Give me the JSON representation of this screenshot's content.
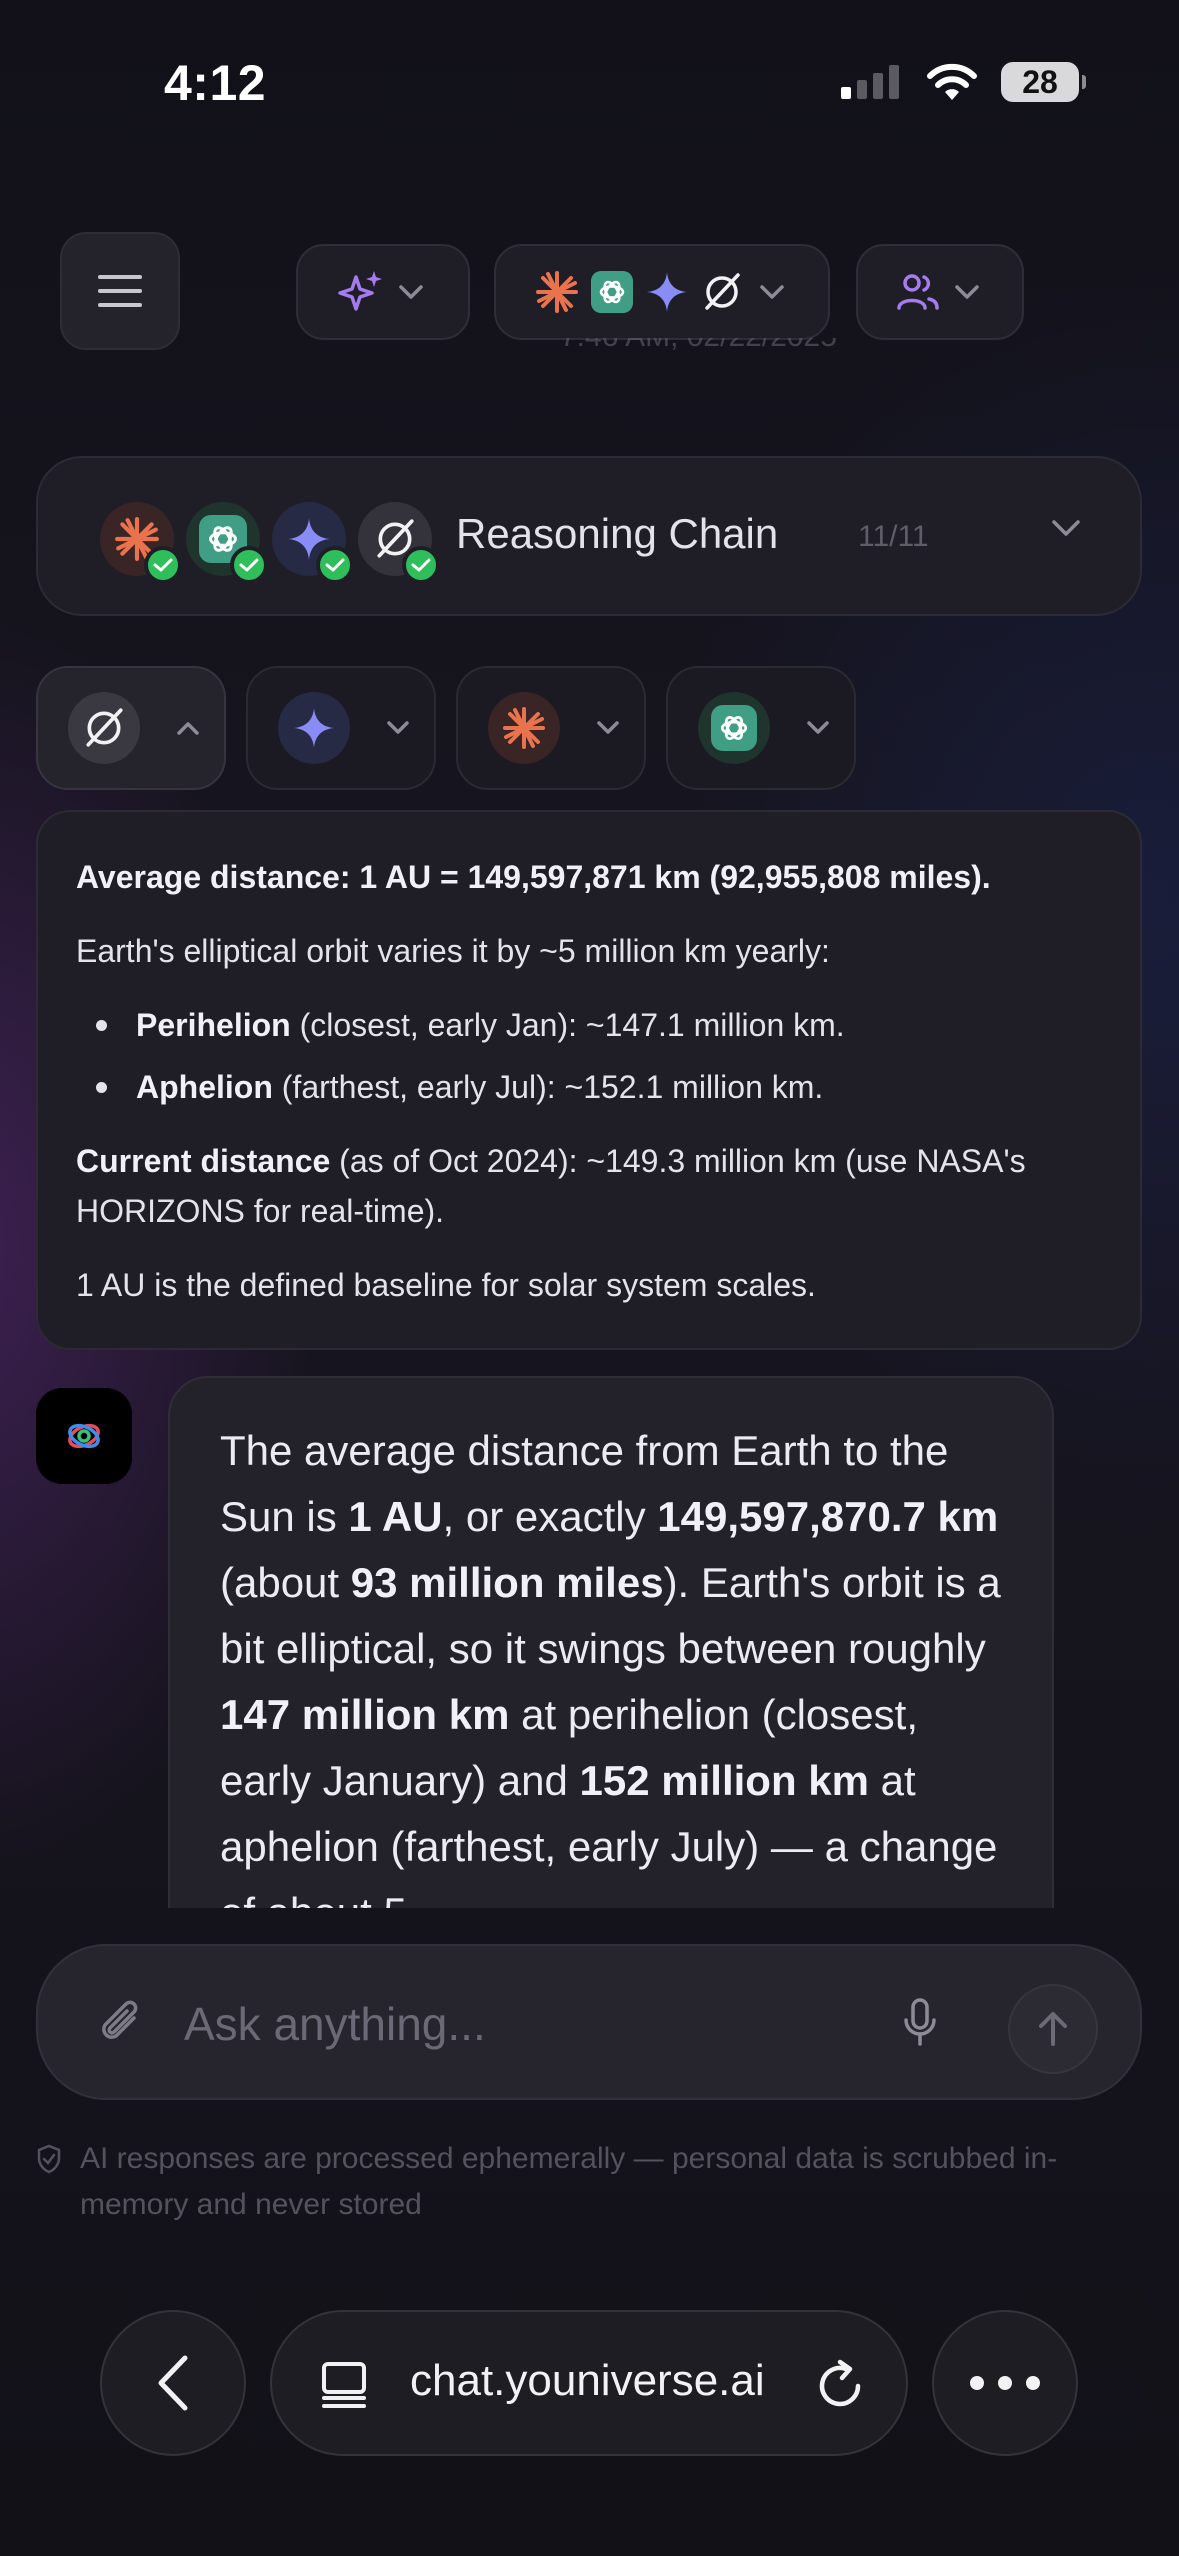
{
  "status_bar": {
    "time": "4:12",
    "battery": "28"
  },
  "header": {
    "faded_timestamp": "7:46 AM, 02/22/2025"
  },
  "reasoning_chain": {
    "title": "Reasoning Chain",
    "count": "11/11"
  },
  "answer_panel": {
    "line1_bold": "Average distance: 1 AU = 149,597,871 km (92,955,808 miles).",
    "line2": "Earth's elliptical orbit varies it by ~5 million km yearly:",
    "bullets": [
      {
        "bold": "Perihelion",
        "text": " (closest, early Jan): ~147.1 million km."
      },
      {
        "bold": "Aphelion",
        "text": " (farthest, early Jul): ~152.1 million km."
      }
    ],
    "current_bold": "Current distance",
    "current_text": " (as of Oct 2024): ~149.3 million km (use NASA's HORIZONS for real-time).",
    "line_last": "1 AU is the defined baseline for solar system scales."
  },
  "assistant_message": {
    "t1": "The average distance from Earth to the Sun is ",
    "b1": "1 AU",
    "t2": ", or exactly ",
    "b2": "149,597,870.7 km",
    "t3": " (about ",
    "b3": "93 million miles",
    "t4": "). Earth's orbit is a bit elliptical, so it swings between roughly ",
    "b4": "147 million km",
    "t5": " at perihelion (closest, early January) and ",
    "b5": "152 million km",
    "t6": " at aphelion (farthest, early July) — a change of about 5"
  },
  "composer": {
    "placeholder": "Ask anything..."
  },
  "disclaimer": "AI responses are processed ephemerally — personal data is scrubbed in-memory and never stored",
  "browser": {
    "url": "chat.youniverse.ai"
  },
  "colors": {
    "claude": "#e8734d",
    "openai_bg": "#3f9e83",
    "gemini": "#8a8cf5",
    "purple_accent": "#a57cf0",
    "check_green": "#2fbf5a"
  }
}
